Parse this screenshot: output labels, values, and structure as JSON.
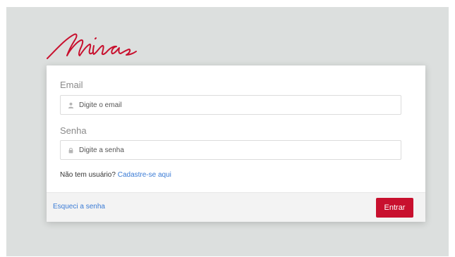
{
  "brand": {
    "logo_text": "Minas",
    "color": "#c8102e"
  },
  "form": {
    "email": {
      "label": "Email",
      "placeholder": "Digite o email",
      "icon": "user-icon"
    },
    "password": {
      "label": "Senha",
      "placeholder": "Digite a senha",
      "icon": "lock-icon"
    },
    "register_prompt": "Não tem usuário?",
    "register_link": "Cadastre-se aqui"
  },
  "footer": {
    "forgot_link": "Esqueci a senha",
    "submit_label": "Entrar"
  },
  "colors": {
    "background": "#dcdfde",
    "link": "#3a7bd5",
    "button": "#c8102e"
  }
}
